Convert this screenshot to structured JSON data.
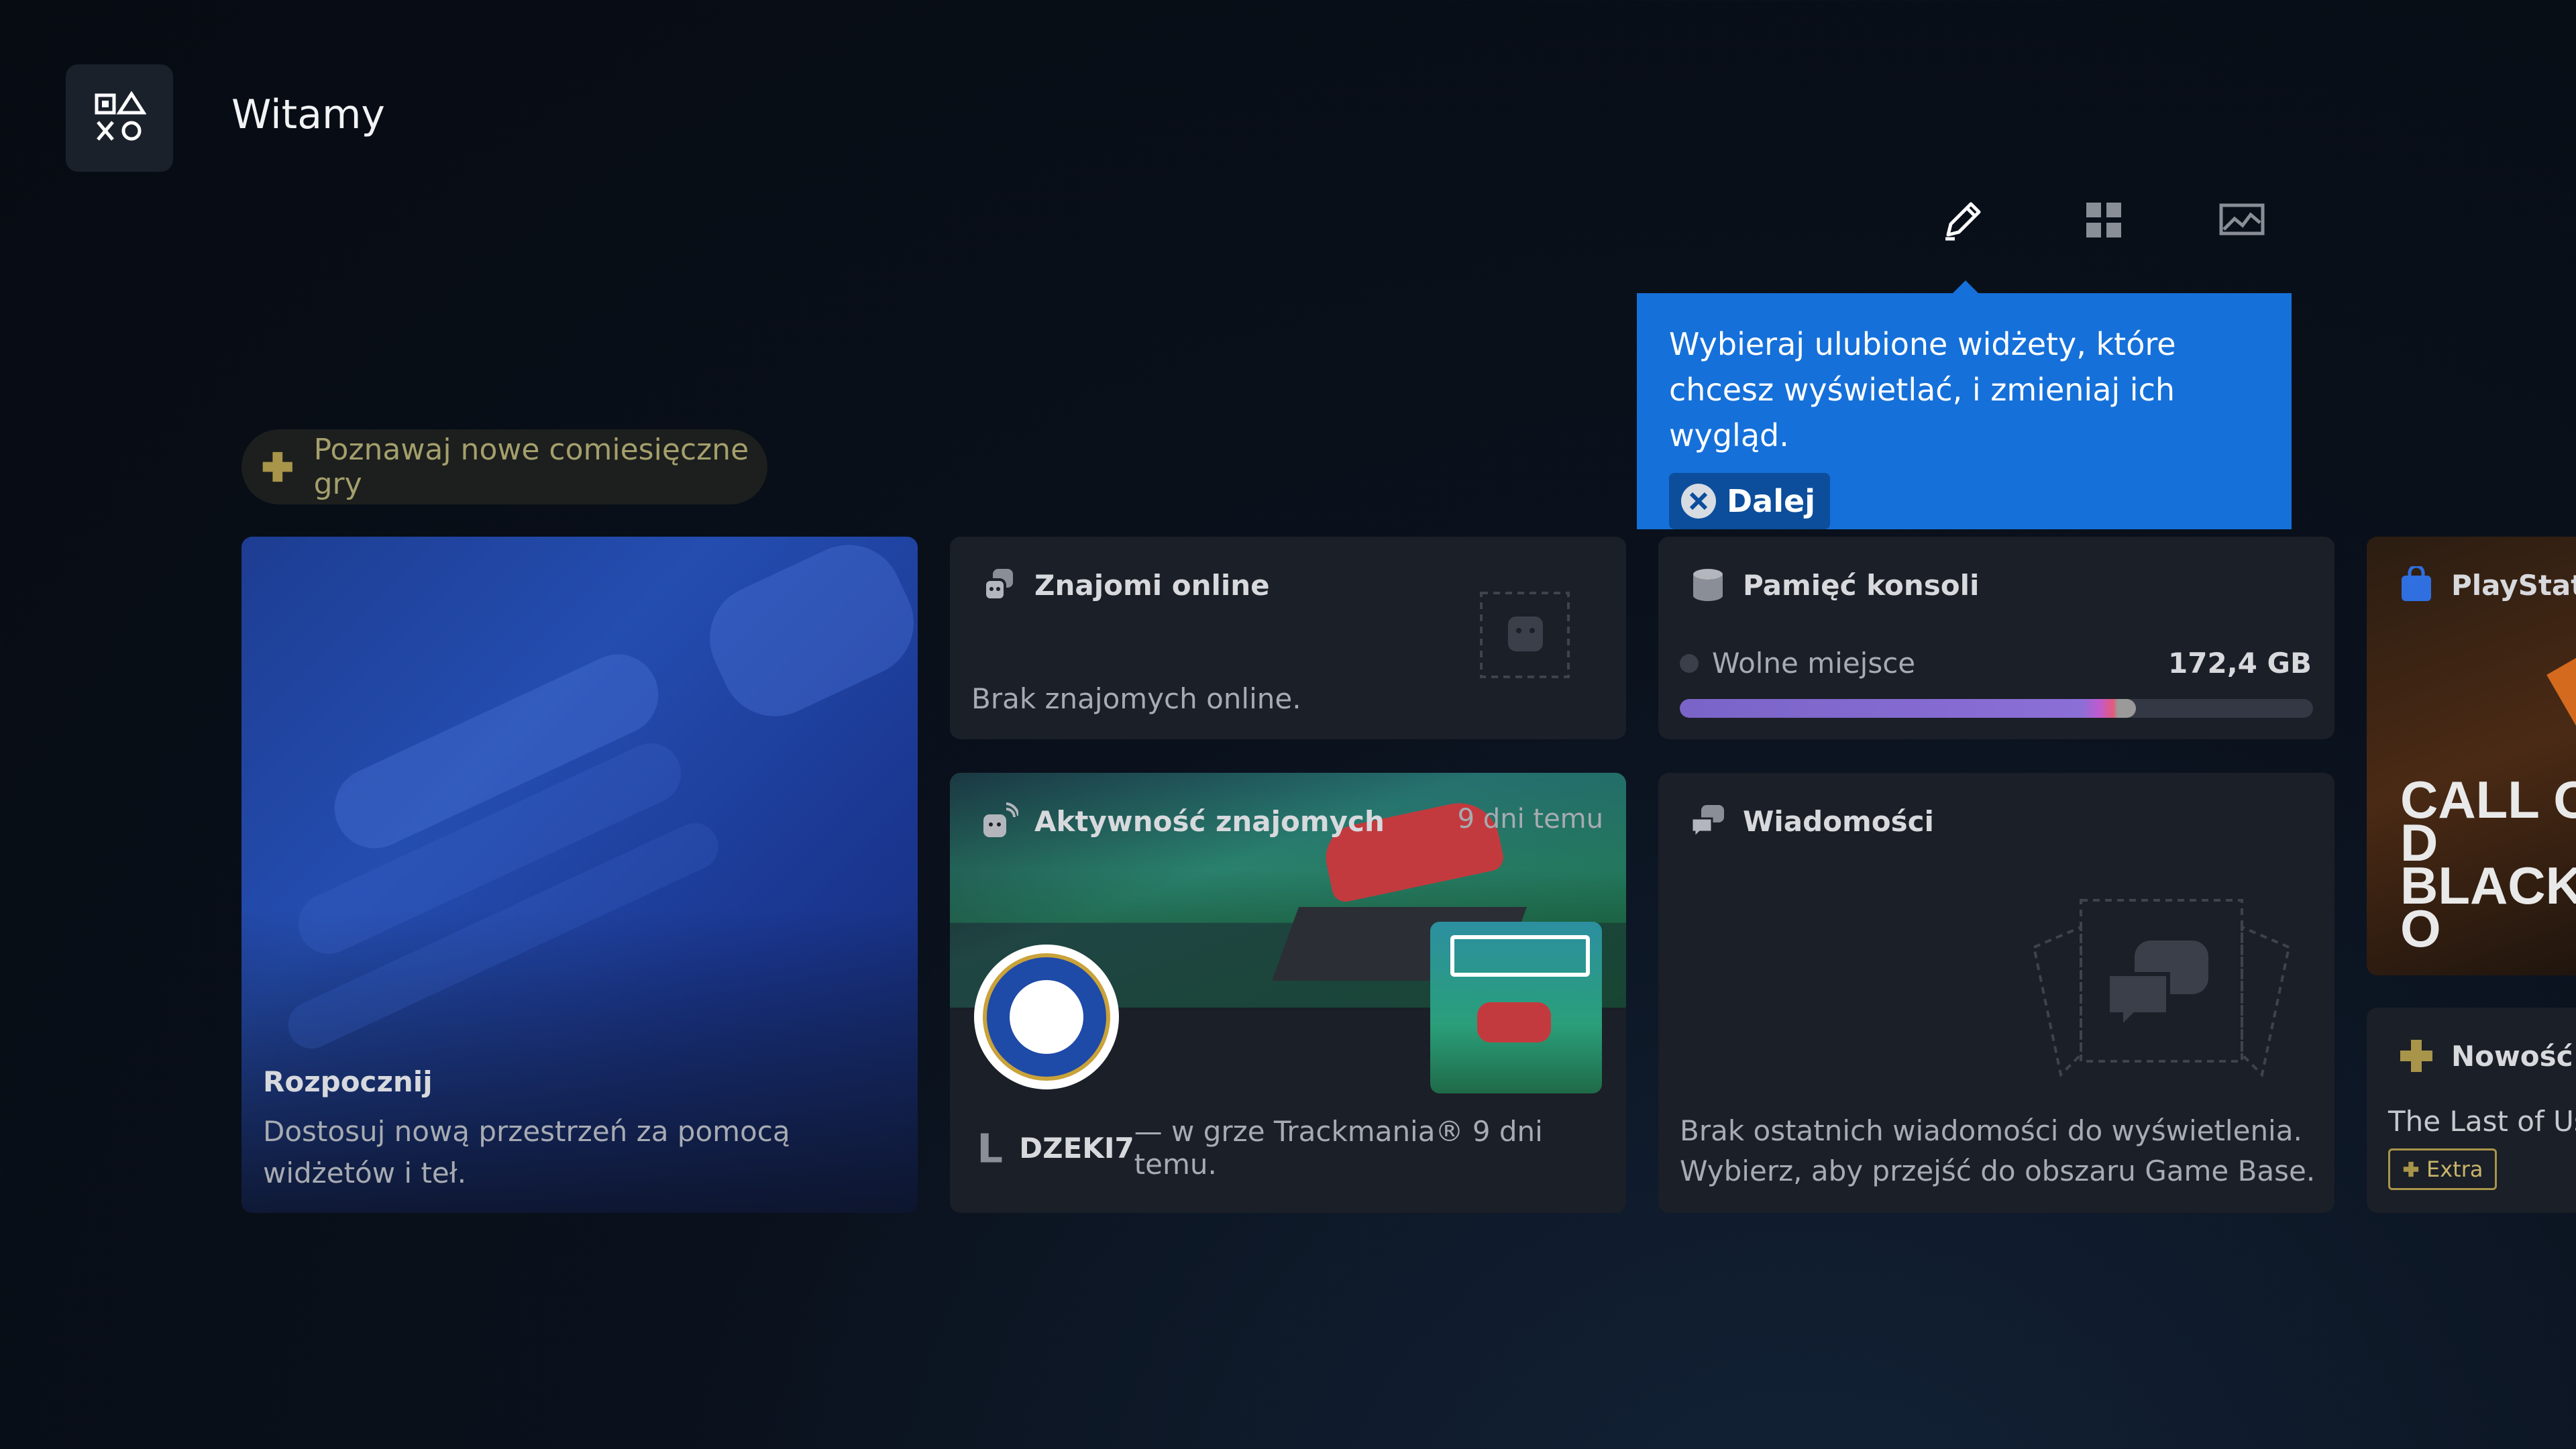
{
  "header": {
    "title": "Witamy"
  },
  "toolbar": {
    "edit_icon": "pencil-icon",
    "widgets_icon": "grid-icon",
    "background_icon": "image-icon"
  },
  "tooltip": {
    "text": "Wybieraj ulubione widżety, które chcesz wyświetlać, i zmieniaj ich wygląd.",
    "button_label": "Dalej",
    "color": "#1570d9"
  },
  "plus_pill": {
    "label": "Poznawaj nowe comiesięczne gry"
  },
  "start_card": {
    "title": "Rozpocznij",
    "description": "Dostosuj nową przestrzeń za pomocą widżetów i teł."
  },
  "friends_card": {
    "title": "Znajomi online",
    "empty_text": "Brak znajomych online."
  },
  "activity_card": {
    "title": "Aktywność znajomych",
    "time": "9 dni temu",
    "user": "DZEKI7",
    "text": " — w grze Trackmania® 9 dni temu."
  },
  "storage_card": {
    "title": "Pamięć konsoli",
    "label": "Wolne miejsce",
    "value": "172,4 GB",
    "used_fraction": 0.72
  },
  "messages_card": {
    "title": "Wiadomości",
    "empty_text": "Brak ostatnich wiadomości do wyświetlenia. Wybierz, aby przejść do obszaru Game Base."
  },
  "ps_card": {
    "title": "PlayStatio"
  },
  "plus_new_card": {
    "title": "Nowość w",
    "game": "The Last of Us™",
    "badge": "Extra"
  }
}
